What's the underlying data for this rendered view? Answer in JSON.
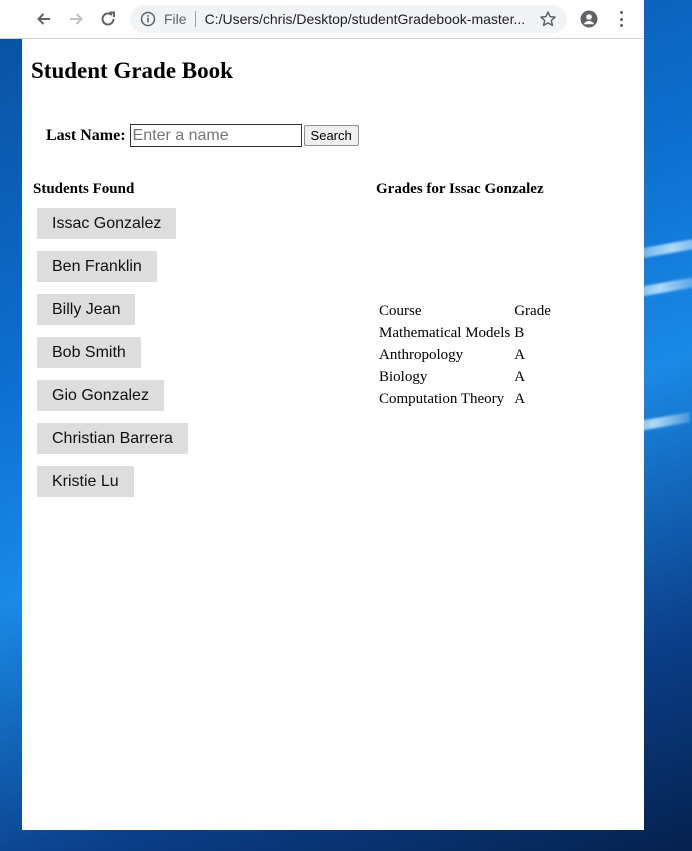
{
  "browser": {
    "scheme_label": "File",
    "url": "C:/Users/chris/Desktop/studentGradebook-master..."
  },
  "page": {
    "title": "Student Grade Book",
    "search": {
      "label": "Last Name:",
      "placeholder": "Enter a name",
      "value": "",
      "button_label": "Search"
    },
    "students_heading": "Students Found",
    "students": [
      "Issac Gonzalez",
      "Ben Franklin",
      "Billy Jean",
      "Bob Smith",
      "Gio Gonzalez",
      "Christian Barrera",
      "Kristie Lu"
    ],
    "grades_heading": "Grades for Issac Gonzalez",
    "grades_table": {
      "headers": [
        "Course",
        "Grade"
      ],
      "rows": [
        [
          "Mathematical Models",
          "B"
        ],
        [
          "Anthropology",
          "A"
        ],
        [
          "Biology",
          "A"
        ],
        [
          "Computation Theory",
          "A"
        ]
      ]
    }
  }
}
